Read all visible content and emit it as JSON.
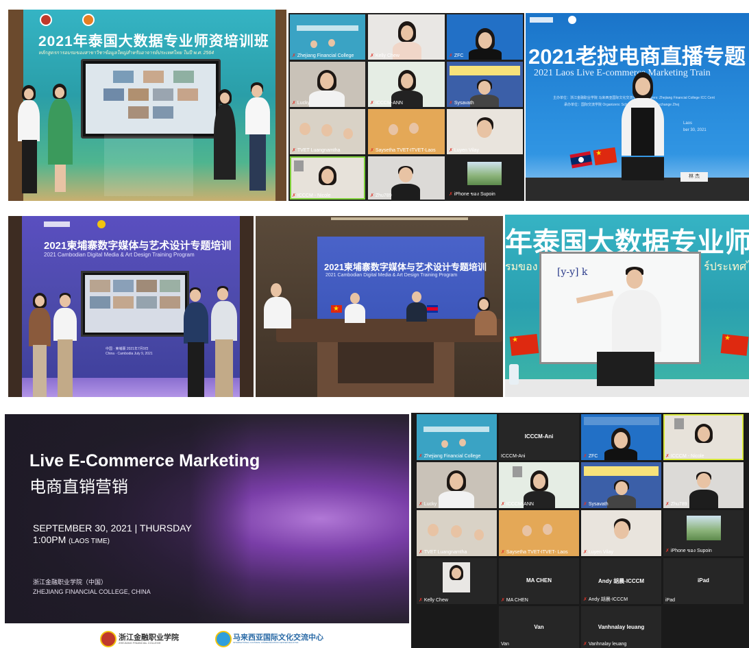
{
  "colors": {
    "thai_banner_bg": "#2a9ea8",
    "laos_banner_bg": "#1f7fd1",
    "cambodia_banner_bg": "#4b4aa8",
    "zoom_bg": "#1f1f1f",
    "slide_bg": "#2c2436",
    "accent_red": "#e0342a"
  },
  "thai_photo": {
    "title": "2021年泰国大数据专业师资培训班",
    "subtitle": "หลักสูตรการอบรมของสาขาวิชาข้อมูลใหญ่สำหรับอาจารย์ประเทศไทย ในปี พ.ศ. 2564"
  },
  "zoom_grid_top": {
    "tiles": [
      {
        "name": "Zhejiang Financial College"
      },
      {
        "name": "Kelly Chew"
      },
      {
        "name": "ZFC"
      },
      {
        "name": "Lucky"
      },
      {
        "name": "ICCCM-ANN"
      },
      {
        "name": "Sysavath"
      },
      {
        "name": "TVET Luangnamtha"
      },
      {
        "name": "Saysetha TVET-ITVET-Laos"
      },
      {
        "name": "Luyen Vilay"
      },
      {
        "name": "ICCCM - Nicole"
      },
      {
        "name": "Zhu789"
      },
      {
        "name": "iPhone ของ Supoin"
      }
    ]
  },
  "laos_banner": {
    "title": "2021老挝电商直播专题",
    "subtitle": "2021 Laos Live E-commerce Marketing Train",
    "org_line1": "主办单位：浙江金融职业学院   马来西亚国际文化交流中心   Organizers: Zhejiang Financial College  ICC Cent",
    "org_line2": "承办单位：国际交流学院   Organizers: School of International Exchange  Zhej",
    "place": "Laos",
    "date": "ber 30, 2021",
    "nameplate": "林 杰"
  },
  "cambodia_photo": {
    "title": "2021柬埔寨数字媒体与艺术设计专题培训",
    "subtitle": "2021 Cambodian Digital Media & Art Design Training Program",
    "footer_cn": "中国 · 柬埔寨 2021年7月9日",
    "footer_en": "China · Cambodia  July 9, 2021"
  },
  "meeting_room": {
    "title": "2021柬埔寨数字媒体与艺术设计专题培训",
    "subtitle": "2021 Cambodian Digital Media & Art Design Training Program"
  },
  "lecture_photo": {
    "banner_cn": "年泰国大数据专业师资",
    "banner_th": "รมของ",
    "banner_th2": "ร์ประเทศไ",
    "whiteboard_text": "[y-y]  k"
  },
  "slide": {
    "title_en": "Live E-Commerce Marketing",
    "title_cn": "电商直销营销",
    "date": "SEPTEMBER 30, 2021 | THURSDAY",
    "time": "1:00PM",
    "timezone": "(LAOS TIME)",
    "org_cn": "浙江金融职业学院（中国）",
    "org_en": "ZHEJIANG FINANCIAL COLLEGE, CHINA",
    "logo1_cn": "浙江金融职业学院",
    "logo1_en": "ZHEJIANG FINANCIAL COLLEGE",
    "logo2_cn": "马来西亚国际文化交流中心",
    "logo2_en": "INTERNATIONAL CULTURAL COMMUNICATION CENTER MALAYSIA"
  },
  "zoom_grid_bottom": {
    "tiles": [
      {
        "name": "Zhejiang Financial College",
        "label": ""
      },
      {
        "name": "ICCCM-Ani",
        "label": "ICCCM-Ani"
      },
      {
        "name": "ZFC",
        "label": ""
      },
      {
        "name": "ICCCM - Nicole",
        "label": ""
      },
      {
        "name": "Lucky",
        "label": ""
      },
      {
        "name": "ICCCM-ANN",
        "label": ""
      },
      {
        "name": "Sysavath",
        "label": ""
      },
      {
        "name": "Zhu789",
        "label": ""
      },
      {
        "name": "TVET Luangnamtha",
        "label": ""
      },
      {
        "name": "Saysetha TVET-ITVET- Laos",
        "label": ""
      },
      {
        "name": "Luyen Vilay",
        "label": ""
      },
      {
        "name": "iPhone ของ Supoin",
        "label": ""
      },
      {
        "name": "Kelly Chew",
        "label": ""
      },
      {
        "name": "MA CHEN",
        "label": "MA CHEN"
      },
      {
        "name": "Andy 胡晨-ICCCM",
        "label": "Andy 胡晨-ICCCM"
      },
      {
        "name": "iPad",
        "label": "iPad"
      },
      {
        "name": "Van",
        "label": "Van"
      },
      {
        "name": "Vanhnalay leuang",
        "label": "Vanhnalay leuang"
      }
    ]
  }
}
